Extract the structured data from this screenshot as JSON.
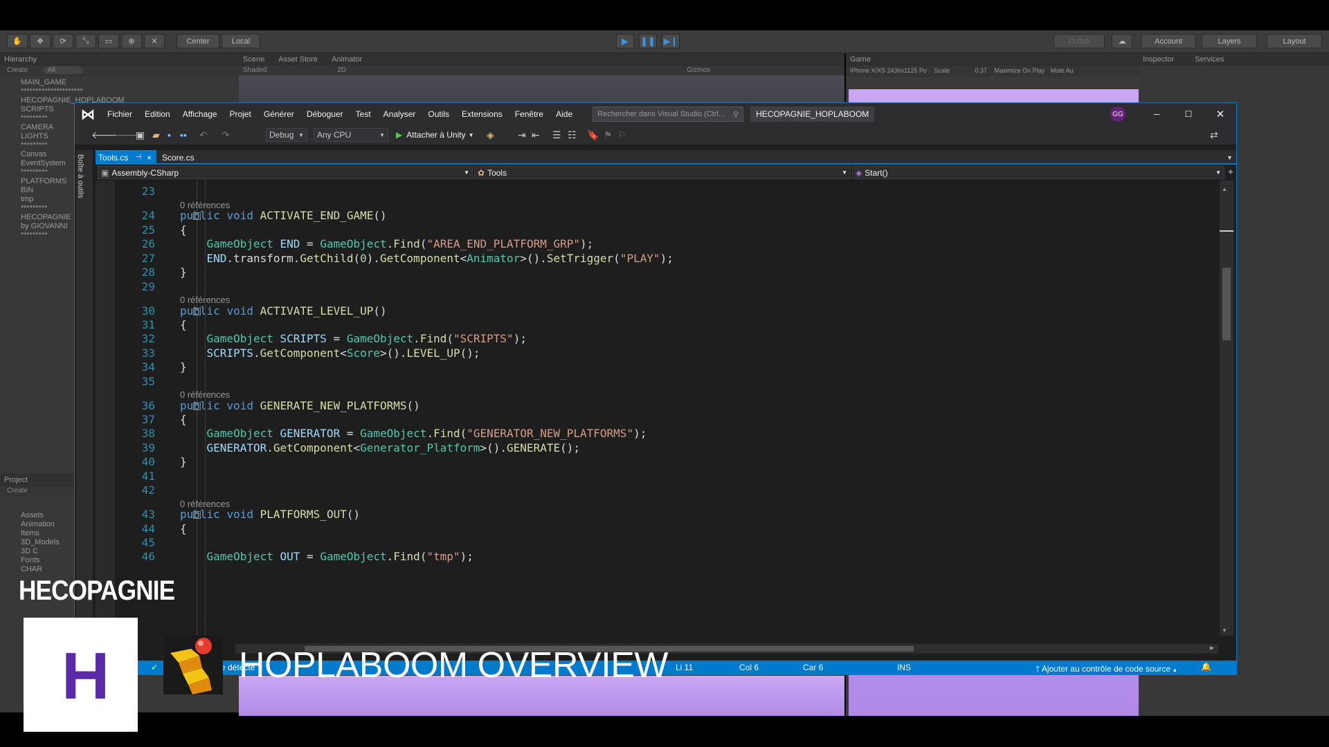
{
  "unity": {
    "pivot_center": "Center",
    "pivot_local": "Local",
    "collab": "Collab",
    "account": "Account",
    "layers": "Layers",
    "layout": "Layout",
    "hierarchy_tab": "Hierarchy",
    "create": "Create",
    "all": "All",
    "scene_tab": "Scene",
    "asset_store_tab": "Asset Store",
    "animator_tab": "Animator",
    "shaded": "Shaded",
    "two_d": "2D",
    "gizmos": "Gizmos",
    "game_tab": "Game",
    "device": "iPhone X/XS 2436x1125 Po",
    "scale": "Scale",
    "scale_val": "0.37",
    "maximize": "Maximize On Play",
    "mute": "Mute Au",
    "inspector_tab": "Inspector",
    "services_tab": "Services",
    "project_tab": "Project",
    "hierarchy": [
      "MAIN_GAME",
      "*********************",
      "HECOPAGNIE_HOPLABOOM",
      "SCRIPTS",
      "*********",
      "CAMERA",
      "LIGHTS",
      "*********",
      "Canvas",
      "EventSystem",
      "*********",
      "PLATFORMS",
      "BIN",
      "tmp",
      "*********",
      "HECOPAGNIE",
      "by GIOVANNI",
      "*********"
    ],
    "assets": [
      "Assets",
      "Animation",
      "Items",
      "3D_Models",
      "3D C",
      "Fonts",
      "CHAR"
    ]
  },
  "vs": {
    "menu": [
      "Fichier",
      "Edition",
      "Affichage",
      "Projet",
      "Générer",
      "Déboguer",
      "Test",
      "Analyser",
      "Outils",
      "Extensions",
      "Fenêtre",
      "Aide"
    ],
    "search_placeholder": "Rechercher dans Visual Studio (Ctrl...",
    "solution": "HECOPAGNIE_HOPLABOOM",
    "user": "GG",
    "config": "Debug",
    "platform": "Any CPU",
    "attach": "Attacher à Unity",
    "side_toolbox": "Boîte à outils",
    "tab_active": "Tools.cs",
    "tab_pin": "⊣",
    "tab_close": "×",
    "tab_other": "Score.cs",
    "nav_project": "Assembly-CSharp",
    "nav_class": "Tools",
    "nav_member": "Start()",
    "status": {
      "detect": "e détecté",
      "line": "Li 11",
      "col": "Col 6",
      "car": "Car 6",
      "ins": "INS",
      "source": "Ajouter au contrôle de code source"
    }
  },
  "code": {
    "lines": [
      "23",
      "24",
      "25",
      "26",
      "27",
      "28",
      "29",
      "30",
      "31",
      "32",
      "33",
      "34",
      "35",
      "36",
      "37",
      "38",
      "39",
      "40",
      "41",
      "42",
      "43",
      "44",
      "45",
      "46"
    ],
    "refs": "0 références"
  },
  "overlay": {
    "brand": "HECOPAGNIE",
    "brand_letter": "H",
    "title": "HOPLABOOM OVERVIEW"
  },
  "colors": {
    "vs_accent": "#007acc",
    "brand_purple": "#5b2aa8",
    "game_bg": "#c9a7f4"
  }
}
